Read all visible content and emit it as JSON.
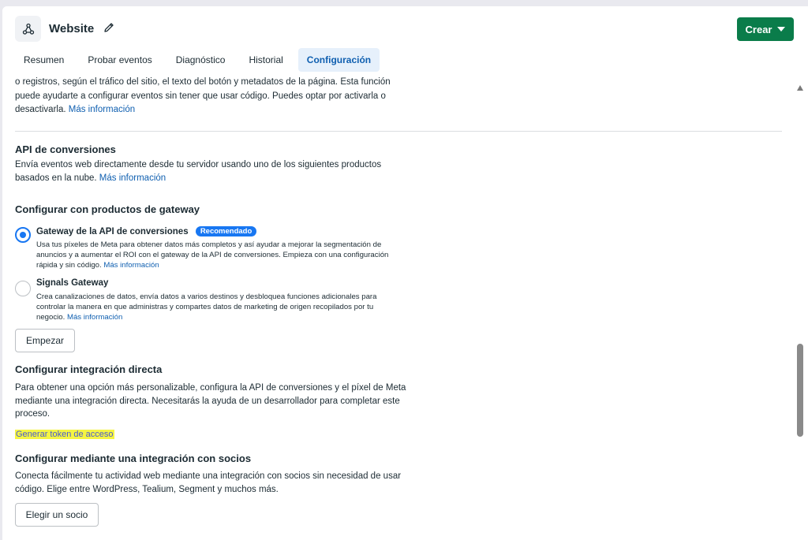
{
  "header": {
    "title": "Website",
    "create_label": "Crear"
  },
  "tabs": [
    {
      "label": "Resumen"
    },
    {
      "label": "Probar eventos"
    },
    {
      "label": "Diagnóstico"
    },
    {
      "label": "Historial"
    },
    {
      "label": "Configuración",
      "active": true
    }
  ],
  "intro": {
    "line1": "o registros, según el tráfico del sitio, el texto del botón y metadatos de la página. Esta función",
    "line2": "puede ayudarte a configurar eventos sin tener que usar código. Puedes optar por activarla o",
    "line3": "desactivarla.",
    "link": "Más información"
  },
  "capi": {
    "heading": "API de conversiones",
    "desc_line1": "Envía eventos web directamente desde tu servidor usando uno de los siguientes productos",
    "desc_line2": "basados en la nube.",
    "link": "Más información"
  },
  "gateway": {
    "heading": "Configurar con productos de gateway",
    "options": [
      {
        "title": "Gateway de la API de conversiones",
        "badge": "Recomendado",
        "line1": "Usa tus píxeles de Meta para obtener datos más completos y así ayudar a mejorar la segmentación de",
        "line2": "anuncios y a aumentar el ROI con el gateway de la API de conversiones. Empieza con una configuración",
        "line3": "rápida y sin código.",
        "link": "Más información",
        "selected": true
      },
      {
        "title": "Signals Gateway",
        "line1": "Crea canalizaciones de datos, envía datos a varios destinos y desbloquea funciones adicionales para",
        "line2": "controlar la manera en que administras y compartes datos de marketing de origen recopilados por tu",
        "line3": "negocio.",
        "link": "Más información",
        "selected": false
      }
    ],
    "start_button": "Empezar"
  },
  "direct": {
    "heading": "Configurar integración directa",
    "line1": "Para obtener una opción más personalizable, configura la API de conversiones y el píxel de Meta",
    "line2": "mediante una integración directa. Necesitarás la ayuda de un desarrollador para completar este",
    "line3": "proceso.",
    "token_link": "Generar token de acceso"
  },
  "partner": {
    "heading": "Configurar mediante una integración con socios",
    "line1": "Conecta fácilmente tu actividad web mediante una integración con socios sin necesidad de usar",
    "line2": "código. Elige entre WordPress, Tealium, Segment y muchos más.",
    "button": "Elegir un socio"
  },
  "colors": {
    "primary_button": "#0a7c4a",
    "link": "#0f5fb0",
    "accent_blue": "#1877f2",
    "highlight": "#f5f542"
  },
  "icons": [
    "network-icon",
    "pencil-icon",
    "caret-down-icon"
  ]
}
